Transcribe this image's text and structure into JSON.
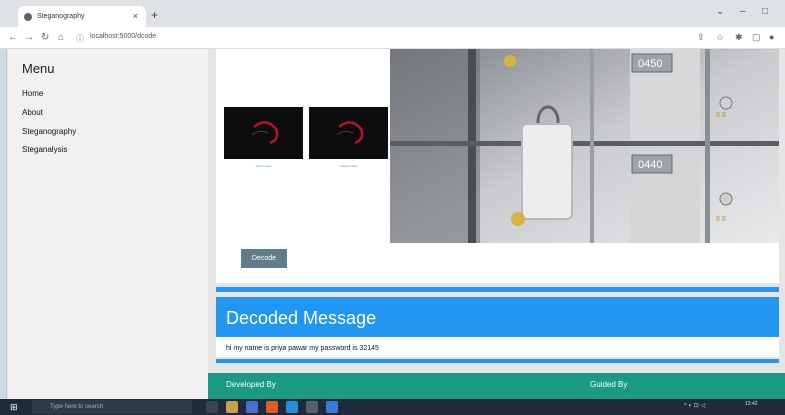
{
  "browser": {
    "tab_title": "Steganography",
    "new_tab": "+",
    "url": "localhost:5000/dcode",
    "window_minimize": "–",
    "window_restore": "□"
  },
  "sidebar": {
    "title": "Menu",
    "items": [
      {
        "label": "Home"
      },
      {
        "label": "About"
      },
      {
        "label": "Steganography"
      },
      {
        "label": "Steganalysis"
      }
    ]
  },
  "main": {
    "thumb_captions": [
      "Input Image",
      "Output Image"
    ],
    "decode_button": "Decode",
    "decoded_title": "Decoded Message",
    "decoded_text": "hi my name is priya pawar my password is 32145",
    "safe_numbers": [
      "0450",
      "0440"
    ]
  },
  "footer": {
    "developed_by": "Developed By",
    "guided_by": "Guided By"
  },
  "taskbar": {
    "search_placeholder": "Type here to search",
    "time": "12:42"
  },
  "colors": {
    "accent_blue": "#2196f3",
    "footer_teal": "#1a9a83",
    "button_grey": "#607d8b"
  }
}
